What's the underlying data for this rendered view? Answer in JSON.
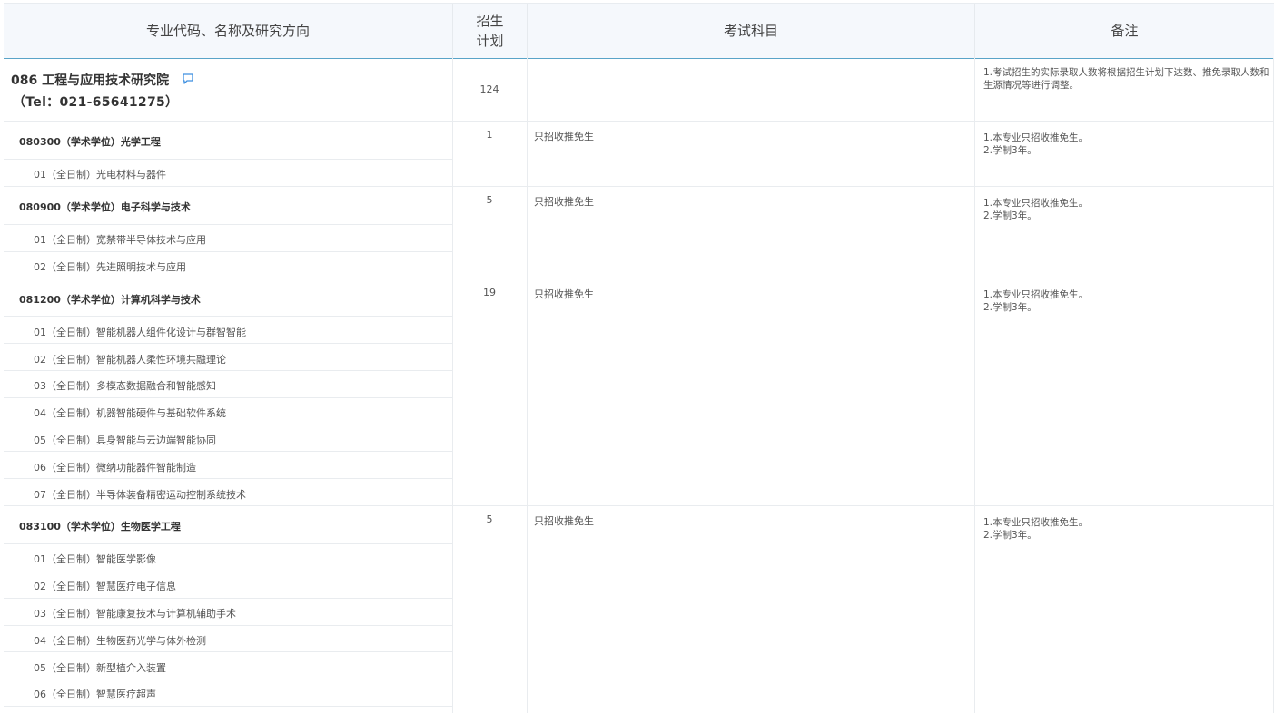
{
  "header": {
    "col1": "专业代码、名称及研究方向",
    "col2_line1": "招生",
    "col2_line2": "计划",
    "col3": "考试科目",
    "col4": "备注"
  },
  "institute": {
    "name": "086 工程与应用技术研究院",
    "tel": "（Tel：021-65641275）",
    "plan": "124",
    "note": "1.考试招生的实际录取人数将根据招生计划下达数、推免录取人数和生源情况等进行调整。",
    "comment_icon": "comment-icon"
  },
  "majors": [
    {
      "title": "080300（学术学位）光学工程",
      "plan": "1",
      "exam": "只招收推免生",
      "note1": "1.本专业只招收推免生。",
      "note2": "2.学制3年。",
      "directions": [
        "01（全日制）光电材料与器件"
      ]
    },
    {
      "title": "080900（学术学位）电子科学与技术",
      "plan": "5",
      "exam": "只招收推免生",
      "note1": "1.本专业只招收推免生。",
      "note2": "2.学制3年。",
      "directions": [
        "01（全日制）宽禁带半导体技术与应用",
        "02（全日制）先进照明技术与应用"
      ]
    },
    {
      "title": "081200（学术学位）计算机科学与技术",
      "plan": "19",
      "exam": "只招收推免生",
      "note1": "1.本专业只招收推免生。",
      "note2": "2.学制3年。",
      "directions": [
        "01（全日制）智能机器人组件化设计与群智智能",
        "02（全日制）智能机器人柔性环境共融理论",
        "03（全日制）多模态数据融合和智能感知",
        "04（全日制）机器智能硬件与基础软件系统",
        "05（全日制）具身智能与云边端智能协同",
        "06（全日制）微纳功能器件智能制造",
        "07（全日制）半导体装备精密运动控制系统技术"
      ]
    },
    {
      "title": "083100（学术学位）生物医学工程",
      "plan": "5",
      "exam": "只招收推免生",
      "note1": "1.本专业只招收推免生。",
      "note2": "2.学制3年。",
      "directions": [
        "01（全日制）智能医学影像",
        "02（全日制）智慧医疗电子信息",
        "03（全日制）智能康复技术与计算机辅助手术",
        "04（全日制）生物医药光学与体外检测",
        "05（全日制）新型植介入装置",
        "06（全日制）智慧医疗超声"
      ]
    }
  ]
}
